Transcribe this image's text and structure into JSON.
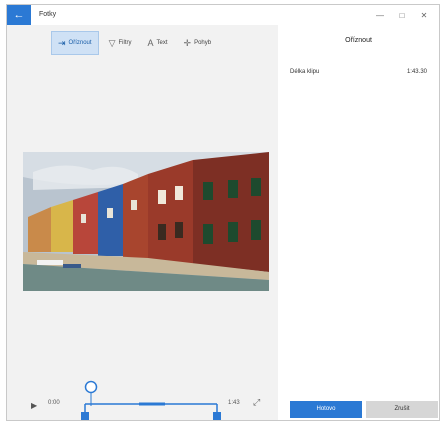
{
  "window": {
    "title": "Fotky",
    "back_icon": "←",
    "minimize": "—",
    "maximize": "□",
    "close": "✕"
  },
  "toolbar": {
    "items": [
      {
        "label": "Oříznout",
        "icon": "trim-icon",
        "glyph": "⇥",
        "active": true
      },
      {
        "label": "Filtry",
        "icon": "filter-icon",
        "glyph": "▽",
        "active": false
      },
      {
        "label": "Text",
        "icon": "text-icon",
        "glyph": "A",
        "active": false
      },
      {
        "label": "Pohyb",
        "icon": "motion-icon",
        "glyph": "✛",
        "active": false
      }
    ]
  },
  "timeline": {
    "play_glyph": "▶",
    "start_time": "0:00",
    "end_time": "1:43",
    "expand_glyph": "⤢"
  },
  "panel": {
    "title": "Oříznout",
    "duration_label": "Délka klipu",
    "duration_value": "1:43.30",
    "confirm_label": "Hotovo",
    "cancel_label": "Zrušit"
  },
  "colors": {
    "accent": "#2b79d4",
    "toolbar_active": "#cfe1f5"
  }
}
